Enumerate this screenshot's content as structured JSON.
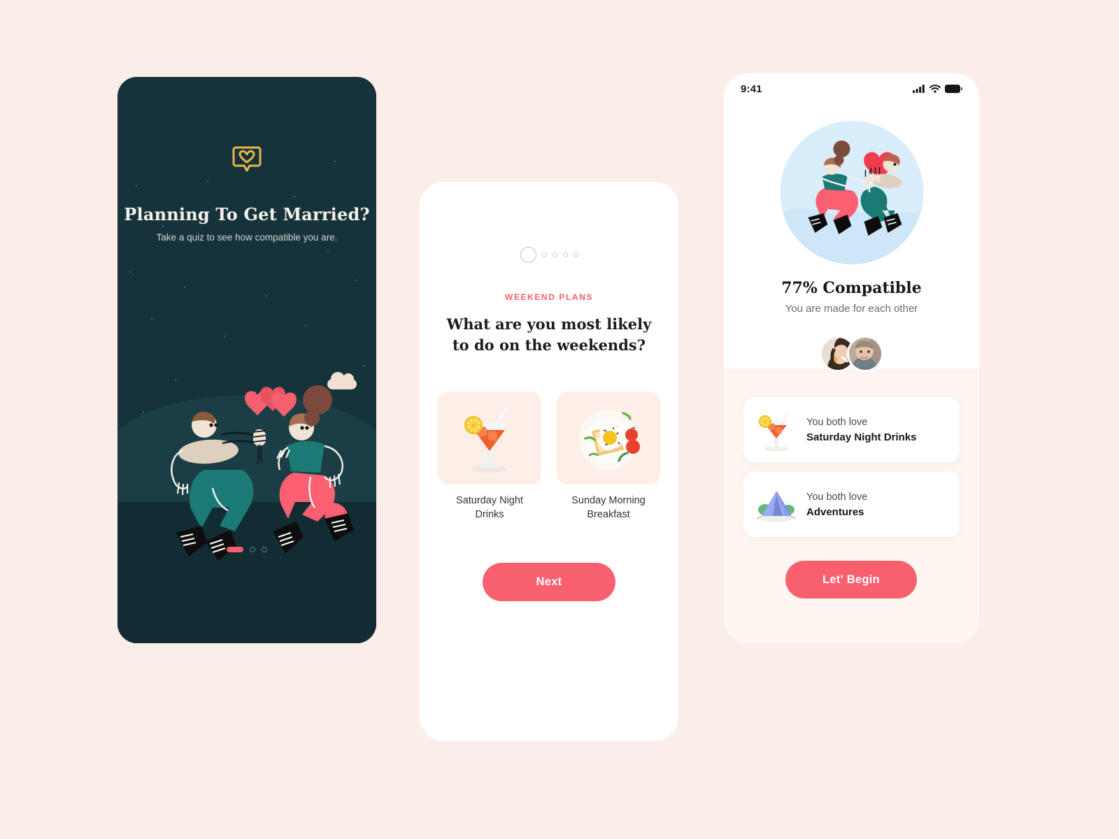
{
  "page": {
    "background_color": "#fbeee8",
    "accent_pink": "#f8606f",
    "dark_navy": "#16333b",
    "gold": "#e8b84b"
  },
  "onboarding_screen": {
    "logo_icon": "heart-speech-bubble-icon",
    "title": "Planning To Get Married?",
    "subtitle": "Take a quiz to see how compatible you are.",
    "illustration": "couple-jumping-with-heart-balloons",
    "pagination": {
      "active_index": 0,
      "total": 3
    }
  },
  "quiz_screen": {
    "progress": {
      "current_step": 1,
      "total_steps": 5
    },
    "eyebrow": "WEEKEND PLANS",
    "question_line1": "What are you most likely",
    "question_line2": "to do on the weekends?",
    "options": [
      {
        "icon": "cocktail-drink-icon",
        "label_line1": "Saturday Night",
        "label_line2": "Drinks"
      },
      {
        "icon": "egg-toast-breakfast-icon",
        "label_line1": "Sunday Morning",
        "label_line2": "Breakfast"
      }
    ],
    "next_label": "Next"
  },
  "result_screen": {
    "status_bar": {
      "time": "9:41",
      "icons": [
        "cellular-signal-icon",
        "wifi-icon",
        "battery-icon"
      ]
    },
    "illustration": "couple-holding-heart-icon",
    "score_text": "77% Compatible",
    "score_percent": 77,
    "tagline": "You are made for each other",
    "avatars": [
      "avatar-woman-laughing",
      "avatar-man"
    ],
    "match_cards": [
      {
        "icon": "cocktail-drink-icon",
        "top_text": "You both love",
        "bottom_text": "Saturday Night Drinks"
      },
      {
        "icon": "camping-tent-icon",
        "top_text": "You both love",
        "bottom_text": "Adventures"
      }
    ],
    "begin_label": "Let' Begin"
  }
}
